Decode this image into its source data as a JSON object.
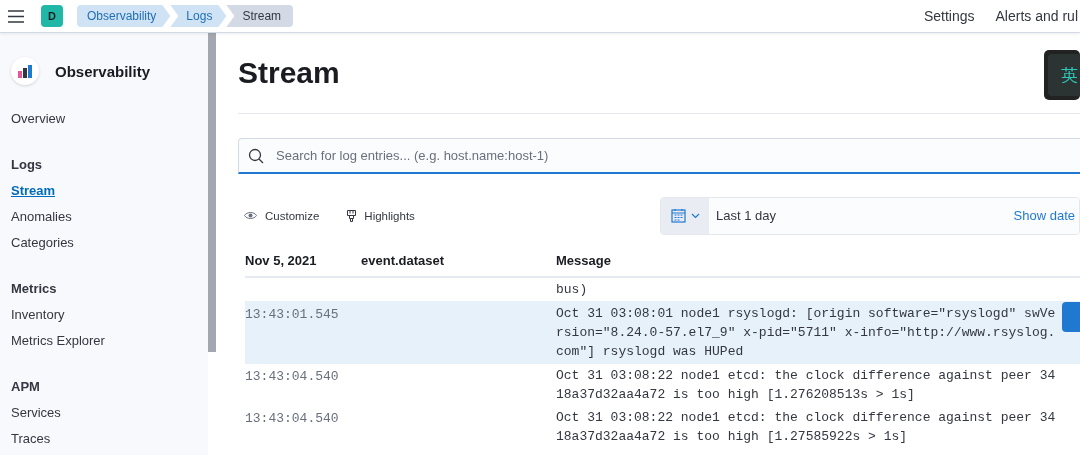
{
  "header": {
    "avatar": "D",
    "breadcrumbs": [
      {
        "label": "Observability",
        "selected": false
      },
      {
        "label": "Logs",
        "selected": false
      },
      {
        "label": "Stream",
        "selected": true
      }
    ],
    "links": [
      "Settings",
      "Alerts and rul"
    ]
  },
  "ime_indicator": "英",
  "sidebar": {
    "title": "Observability",
    "sections": [
      {
        "items": [
          {
            "label": "Overview",
            "selected": false
          }
        ]
      },
      {
        "heading": "Logs",
        "items": [
          {
            "label": "Stream",
            "selected": true
          },
          {
            "label": "Anomalies",
            "selected": false
          },
          {
            "label": "Categories",
            "selected": false
          }
        ]
      },
      {
        "heading": "Metrics",
        "items": [
          {
            "label": "Inventory",
            "selected": false
          },
          {
            "label": "Metrics Explorer",
            "selected": false
          }
        ]
      },
      {
        "heading": "APM",
        "items": [
          {
            "label": "Services",
            "selected": false
          },
          {
            "label": "Traces",
            "selected": false
          }
        ]
      }
    ]
  },
  "page_title": "Stream",
  "search": {
    "placeholder": "Search for log entries... (e.g. host.name:host-1)"
  },
  "toolbar": [
    {
      "kind": "customize",
      "label": "Customize"
    },
    {
      "kind": "highlights",
      "label": "Highlights"
    }
  ],
  "date_picker": {
    "range": "Last 1 day",
    "link": "Show date"
  },
  "table": {
    "columns": [
      "Nov 5, 2021",
      "event.dataset",
      "Message"
    ],
    "rows": [
      {
        "message": "bus)",
        "selected": false
      },
      {
        "time": "13:43:01.545",
        "message": "Oct 31 03:08:01 node1 rsyslogd: [origin software=\"rsyslogd\" swVersion=\"8.24.0-57.el7_9\" x-pid=\"5711\" x-info=\"http://www.rsyslog.com\"] rsyslogd was HUPed",
        "selected": true
      },
      {
        "time": "13:43:04.540",
        "message": "Oct 31 03:08:22 node1 etcd: the clock difference against peer 3418a37d32aa4a72 is too high [1.276208513s > 1s]",
        "selected": false
      },
      {
        "time": "13:43:04.540",
        "message": "Oct 31 03:08:22 node1 etcd: the clock difference against peer 3418a37d32aa4a72 is too high [1.27585922s > 1s]",
        "selected": false
      }
    ]
  }
}
